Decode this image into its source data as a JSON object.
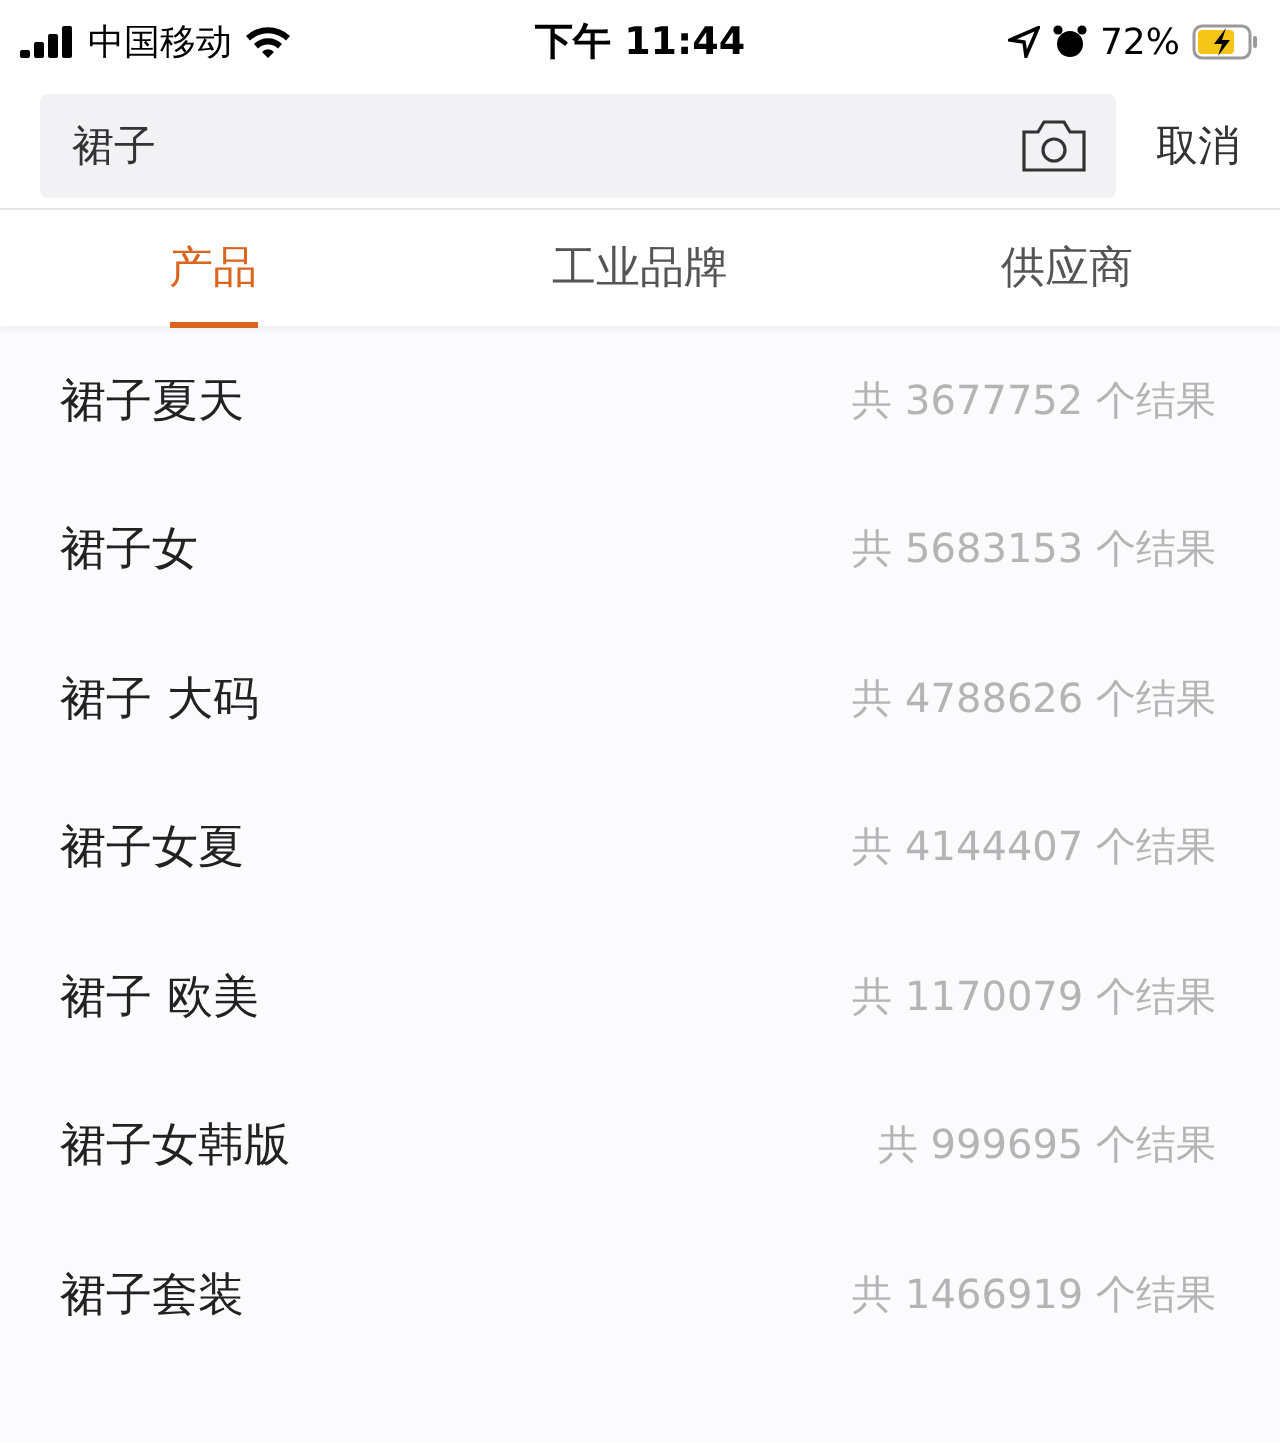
{
  "status_bar": {
    "carrier": "中国移动",
    "time": "下午 11:44",
    "battery": "72%"
  },
  "search": {
    "value": "裙子",
    "cancel": "取消"
  },
  "tabs": [
    {
      "label": "产品",
      "selected": true
    },
    {
      "label": "工业品牌",
      "selected": false
    },
    {
      "label": "供应商",
      "selected": false
    }
  ],
  "results": [
    {
      "name": "裙子夏天",
      "count": "共 3677752 个结果"
    },
    {
      "name": "裙子女",
      "count": "共 5683153 个结果"
    },
    {
      "name": "裙子 大码",
      "count": "共 4788626 个结果"
    },
    {
      "name": "裙子女夏",
      "count": "共 4144407 个结果"
    },
    {
      "name": "裙子 欧美",
      "count": "共 1170079 个结果"
    },
    {
      "name": "裙子女韩版",
      "count": "共 999695 个结果"
    },
    {
      "name": "裙子套装",
      "count": "共 1466919 个结果"
    }
  ]
}
